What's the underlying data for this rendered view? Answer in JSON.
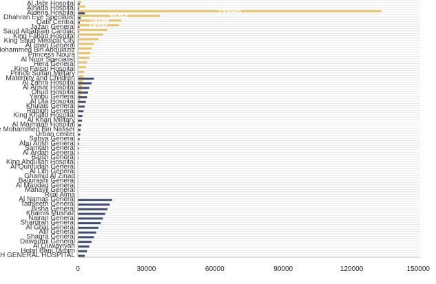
{
  "chart_data": {
    "type": "bar",
    "orientation": "horizontal",
    "grid": true,
    "xlim": [
      0,
      150000
    ],
    "x_ticks": [
      0,
      30000,
      60000,
      90000,
      120000,
      150000
    ],
    "x_tick_labels": [
      "0",
      "30000",
      "60000",
      "90000",
      "120000",
      "150000"
    ],
    "colors": {
      "series_gold": "#e8c46a",
      "series_navy": "#3e4a6e",
      "grid": "#e4e4e4",
      "label": "#333333"
    },
    "series": [
      {
        "color_key": "series_gold",
        "values": [
          1500,
          3200,
          133000,
          36000,
          19000,
          18000,
          13000,
          11000,
          9000,
          7000,
          6000,
          5500,
          5000,
          4000,
          3500,
          2800,
          2500,
          2200,
          1800,
          1500,
          1200,
          900,
          700,
          500,
          400,
          300,
          250,
          200,
          150,
          120,
          100,
          90,
          80,
          70,
          60,
          50,
          40,
          30,
          25,
          20,
          15,
          12,
          10,
          9,
          8,
          7,
          6,
          5,
          4,
          3,
          2,
          2,
          1,
          1,
          1
        ]
      },
      {
        "color_key": "series_navy",
        "values": [
          800,
          600,
          3000,
          1200,
          900,
          700,
          500,
          400,
          300,
          250,
          200,
          150,
          120,
          100,
          90,
          80,
          7000,
          6000,
          5000,
          4500,
          4000,
          3500,
          3000,
          2500,
          2000,
          1800,
          1500,
          1200,
          1000,
          800,
          600,
          500,
          400,
          300,
          200,
          150,
          100,
          80,
          60,
          40,
          30,
          20,
          15000,
          14000,
          13000,
          12000,
          11000,
          10000,
          9000,
          8000,
          7000,
          6000,
          5000,
          4000,
          3000
        ]
      }
    ],
    "data_labels": [
      {
        "row": 2,
        "text": "133000"
      },
      {
        "row": 3,
        "text": "36450"
      },
      {
        "row": 4,
        "text": "19180"
      },
      {
        "row": 5,
        "text": "18230"
      }
    ],
    "row_labels": [
      "Al Jabr Hospital",
      "Alhada Hospital",
      "Alderia Hospital",
      "Dhahran Eye Specialist",
      "Qatif Central",
      "Jazan General",
      "Saud Albabtain Cardiac",
      "King Fahad Hospital",
      "King Saud Medical City",
      "Al Iman General",
      "Prince Mohammed Bin Abdulaziz",
      "Princess Noura",
      "Al Noor Specialist",
      "Hera General",
      "King Faisal Hospital",
      "Prince Sultan Military",
      "Maternity and Children",
      "Al Zahra Hospital",
      "Al Ansar Hospital",
      "Ohud Hospital",
      "Yanbu General",
      "Al Ula Hospital",
      "Khulais General",
      "Rabigh General",
      "King Khalid Hospital",
      "Al Kharj Military",
      "Al Majmaah Hospital",
      "Prince Mohammed Bin Nasser",
      "Urban center",
      "Sabya General",
      "Abu Arish General",
      "Samtah General",
      "Al Ardah General",
      "Baish General",
      "King Abdullah Hospital",
      "Al Qunfudah General",
      "Al Lith General",
      "Ghamid Al Zinad",
      "Baljurashi General",
      "Al Mandaq General",
      "Mahayil General",
      "Rijal Alma",
      "Al Namas General",
      "Tathleeth General",
      "Bisha General",
      "Khamis Mushait",
      "Najran General",
      "Sharurah General",
      "Al Ghat General",
      "Afif General",
      "Shaqra General",
      "Dawadmi General",
      "Al Quwayiyah",
      "Hotat Bani Tamim",
      "SHAROHAH GENERAL HOSPITAL"
    ]
  }
}
